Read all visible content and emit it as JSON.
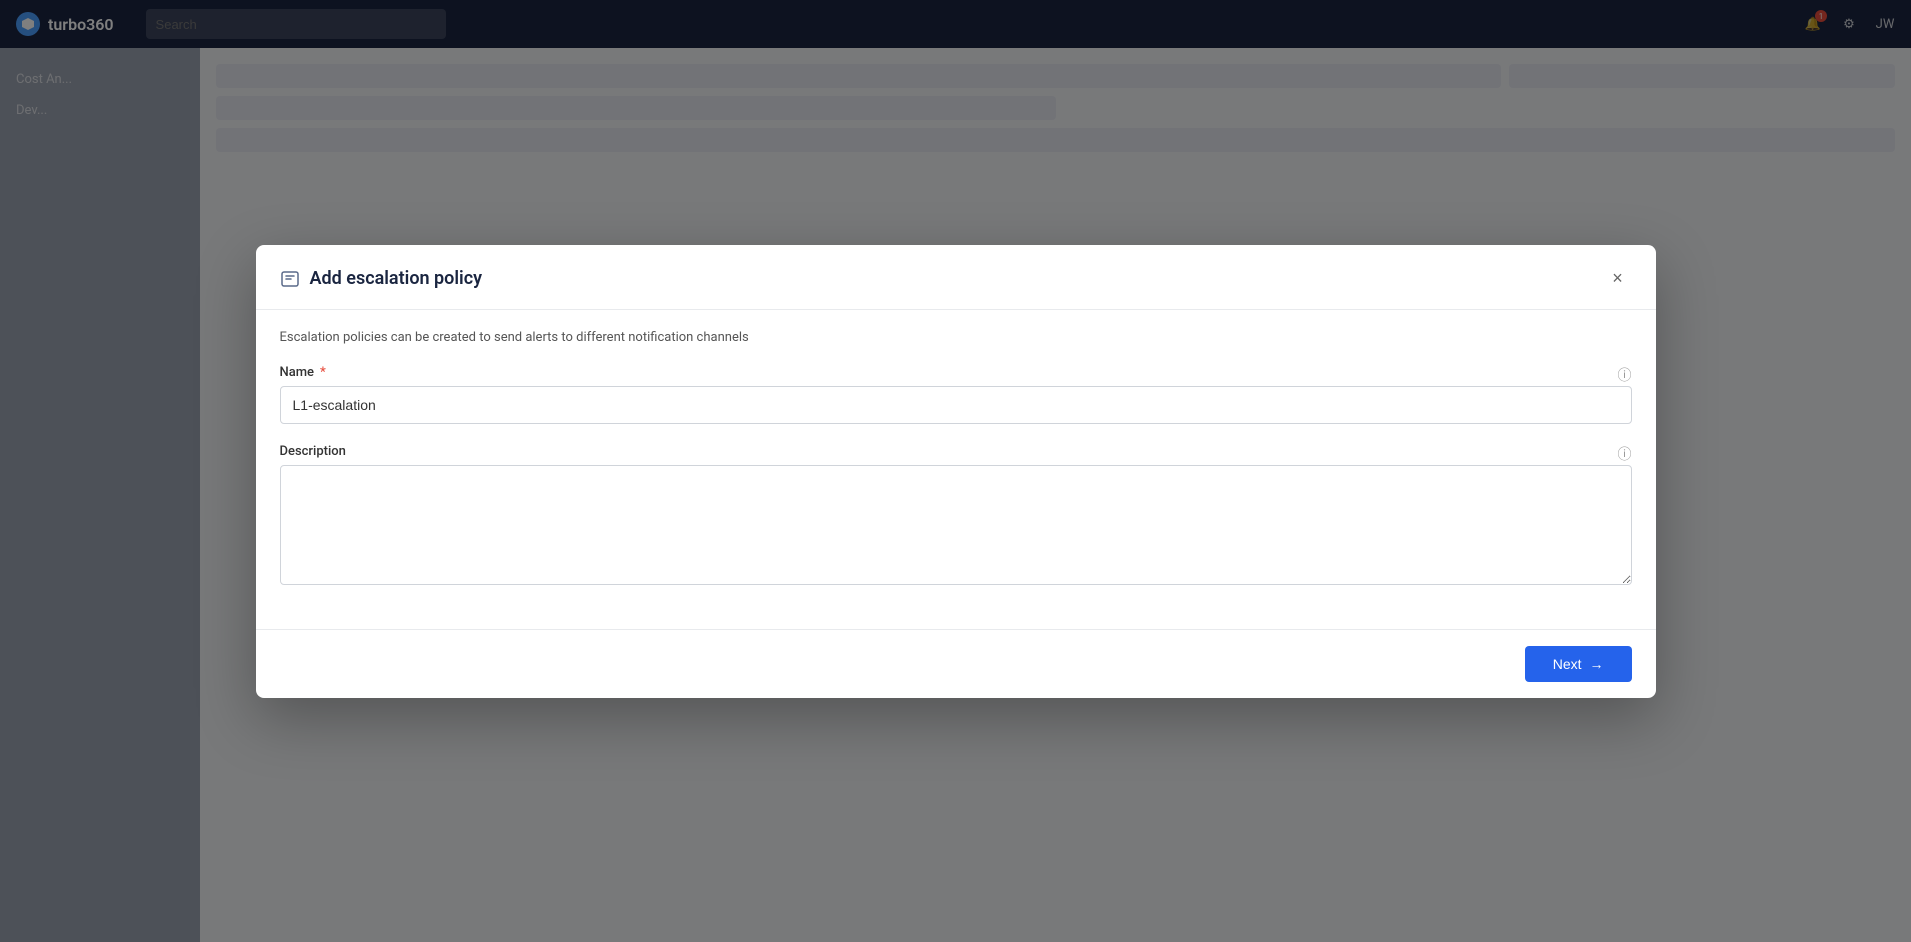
{
  "app": {
    "logo_text": "turbo360",
    "search_placeholder": "Search"
  },
  "header": {
    "notification_count": "1",
    "user_initials": "JW"
  },
  "modal": {
    "title": "Add escalation policy",
    "subtitle": "Escalation policies can be created to send alerts to different notification channels",
    "close_label": "×",
    "form": {
      "name_label": "Name",
      "name_required": "*",
      "name_value": "L1-escalation",
      "name_placeholder": "",
      "description_label": "Description",
      "description_value": "",
      "description_placeholder": ""
    },
    "footer": {
      "next_label": "Next",
      "next_arrow": "→"
    }
  }
}
